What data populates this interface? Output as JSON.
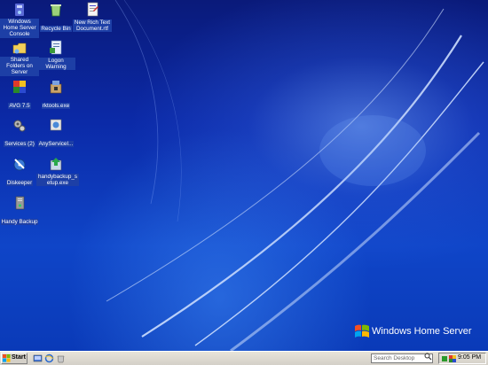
{
  "desktop": {
    "icons": [
      {
        "label": "Windows Home Server Console",
        "icon": "home-server-console-icon"
      },
      {
        "label": "Recycle Bin",
        "icon": "recycle-bin-icon"
      },
      {
        "label": "New Rich Text Document.rtf",
        "icon": "rtf-document-icon"
      },
      {
        "label": "Shared Folders on Server",
        "icon": "shared-folders-icon"
      },
      {
        "label": "Logon Warning",
        "icon": "logon-warning-icon"
      },
      {
        "label": "AVG 7.5",
        "icon": "avg-antivirus-icon"
      },
      {
        "label": "rktools.exe",
        "icon": "rktools-installer-icon"
      },
      {
        "label": "Services (2)",
        "icon": "services-gears-icon"
      },
      {
        "label": "AnyServiceI...",
        "icon": "anyservice-icon"
      },
      {
        "label": "Diskeeper",
        "icon": "diskeeper-icon"
      },
      {
        "label": "handybackup_setup.exe",
        "icon": "handybackup-setup-icon"
      },
      {
        "label": "Handy Backup",
        "icon": "handy-backup-icon"
      }
    ]
  },
  "branding": {
    "product_name": "Windows Home Server"
  },
  "taskbar": {
    "start_label": "Start",
    "quick_launch": [
      "desktop-icon",
      "internet-explorer-icon",
      "recycle-bin-icon"
    ],
    "search_placeholder": "Search Desktop",
    "clock": "9:05 PM"
  },
  "colors": {
    "desktop_blue": "#0b2aa8",
    "label_highlight": "#1d3fa6",
    "taskbar": "#d4d0c8"
  }
}
